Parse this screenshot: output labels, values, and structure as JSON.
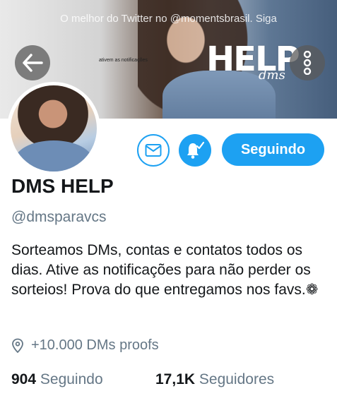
{
  "banner": {
    "caption": "O melhor do Twitter no @momentsbrasil. Siga",
    "small_text": "ativem as notificações",
    "logo_text": "HELP",
    "logo_sub": "dms"
  },
  "nav": {
    "back_icon": "arrow-left-icon",
    "more_icon": "vertical-dots-icon"
  },
  "actions": {
    "message_icon": "envelope-icon",
    "notify_icon": "bell-check-icon",
    "follow_label": "Seguindo",
    "accent_color": "#1da1f2"
  },
  "profile": {
    "name": "DMS HELP",
    "handle": "@dmsparavcs",
    "bio": "Sorteamos DMs, contas e contatos todos os dias. Ative as notificações para não perder os sorteios! Prova do que entregamos nos favs.❁",
    "location": "+10.000 DMs proofs",
    "location_icon": "location-pin-icon"
  },
  "stats": {
    "following_count": "904",
    "following_label": "Seguindo",
    "followers_count": "17,1K",
    "followers_label": "Seguidores"
  }
}
